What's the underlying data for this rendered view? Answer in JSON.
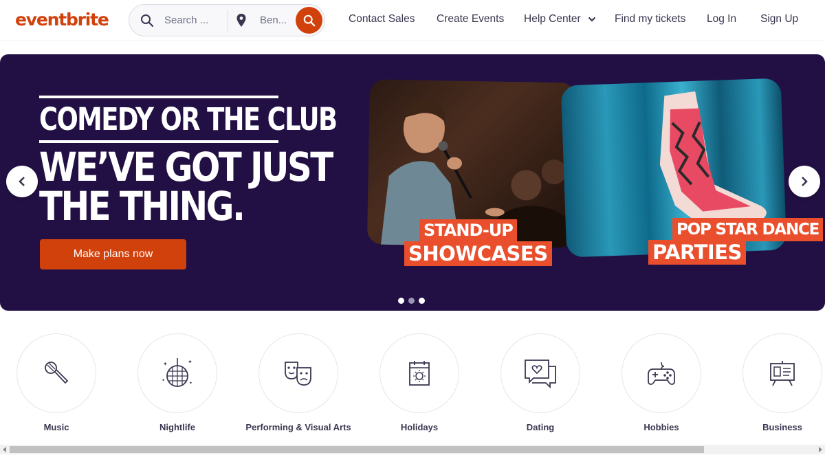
{
  "header": {
    "logo": "eventbrite",
    "search_placeholder": "Search ...",
    "location": "Ben...",
    "nav": {
      "contact_sales": "Contact Sales",
      "create_events": "Create Events",
      "help_center": "Help Center",
      "find_tickets": "Find my tickets",
      "log_in": "Log In",
      "sign_up": "Sign Up"
    }
  },
  "hero": {
    "tagline_1": "COMEDY OR THE CLUB",
    "tagline_2_line1": "WE’VE GOT JUST",
    "tagline_2_line2": "THE THING.",
    "cta": "Make plans now",
    "card1": {
      "line1": "STAND-UP",
      "line2": "SHOWCASES"
    },
    "card2": {
      "line1": "POP STAR DANCE",
      "line2": "PARTIES"
    }
  },
  "categories": [
    {
      "label": "Music",
      "icon": "microphone-icon"
    },
    {
      "label": "Nightlife",
      "icon": "disco-ball-icon"
    },
    {
      "label": "Performing & Visual Arts",
      "icon": "theater-masks-icon"
    },
    {
      "label": "Holidays",
      "icon": "calendar-sun-icon"
    },
    {
      "label": "Dating",
      "icon": "chat-heart-icon"
    },
    {
      "label": "Hobbies",
      "icon": "gamepad-icon"
    },
    {
      "label": "Business",
      "icon": "presentation-board-icon"
    }
  ],
  "colors": {
    "brand": "#d1410c",
    "hero_bg": "#221044",
    "label_bg": "#e94f2d",
    "text": "#39364f"
  }
}
